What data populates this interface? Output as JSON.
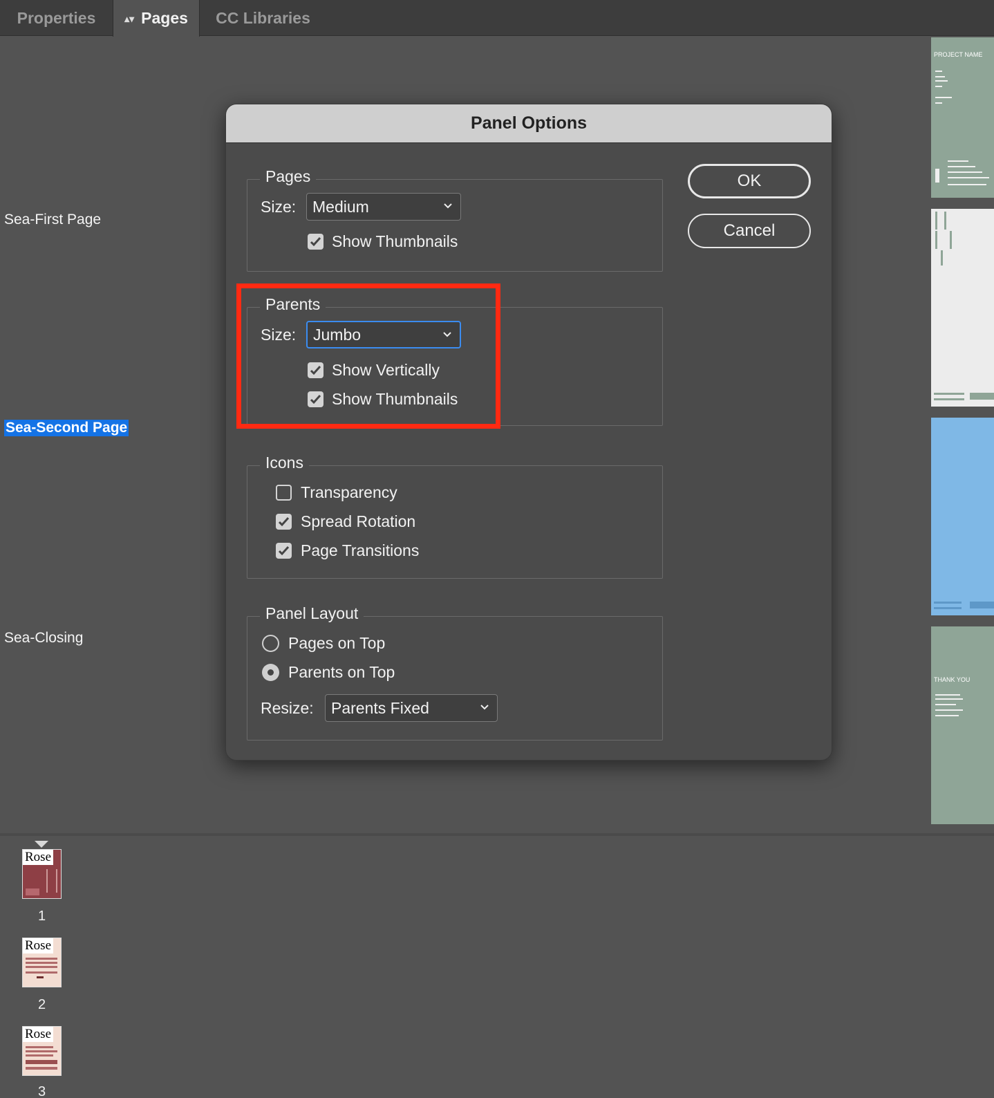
{
  "tabs": [
    {
      "label": "Properties"
    },
    {
      "label": "Pages"
    },
    {
      "label": "CC Libraries"
    }
  ],
  "parents_list": [
    {
      "label": "Sea-First Page"
    },
    {
      "label": "Sea-Second Page"
    },
    {
      "label": "Sea-Closing"
    }
  ],
  "parent_thumbnails": [
    {
      "title": "PROJECT NAME",
      "color": "#8fa597"
    },
    {
      "title": "",
      "color": "#ececec"
    },
    {
      "title": "",
      "color": "#7fb8e6"
    },
    {
      "title": "THANK YOU",
      "color": "#8fa597"
    }
  ],
  "pages": [
    {
      "parent": "Rose",
      "number": "1"
    },
    {
      "parent": "Rose",
      "number": "2"
    },
    {
      "parent": "Rose",
      "number": "3"
    }
  ],
  "dialog": {
    "title": "Panel Options",
    "ok_label": "OK",
    "cancel_label": "Cancel",
    "pages_group": {
      "legend": "Pages",
      "size_label": "Size:",
      "size_value": "Medium",
      "show_thumbnails": {
        "label": "Show Thumbnails",
        "checked": true
      }
    },
    "parents_group": {
      "legend": "Parents",
      "size_label": "Size:",
      "size_value": "Jumbo",
      "show_vertically": {
        "label": "Show Vertically",
        "checked": true
      },
      "show_thumbnails": {
        "label": "Show Thumbnails",
        "checked": true
      }
    },
    "icons_group": {
      "legend": "Icons",
      "transparency": {
        "label": "Transparency",
        "checked": false
      },
      "spread_rotation": {
        "label": "Spread Rotation",
        "checked": true
      },
      "page_transitions": {
        "label": "Page Transitions",
        "checked": true
      }
    },
    "layout_group": {
      "legend": "Panel Layout",
      "pages_on_top": {
        "label": "Pages on Top",
        "selected": false
      },
      "parents_on_top": {
        "label": "Parents on Top",
        "selected": true
      },
      "resize_label": "Resize:",
      "resize_value": "Parents Fixed"
    }
  },
  "colors": {
    "accent_blue": "#1473e6",
    "highlight_red": "#ff2a12",
    "panel_bg": "#535353",
    "dialog_bg": "#4b4b4b"
  }
}
